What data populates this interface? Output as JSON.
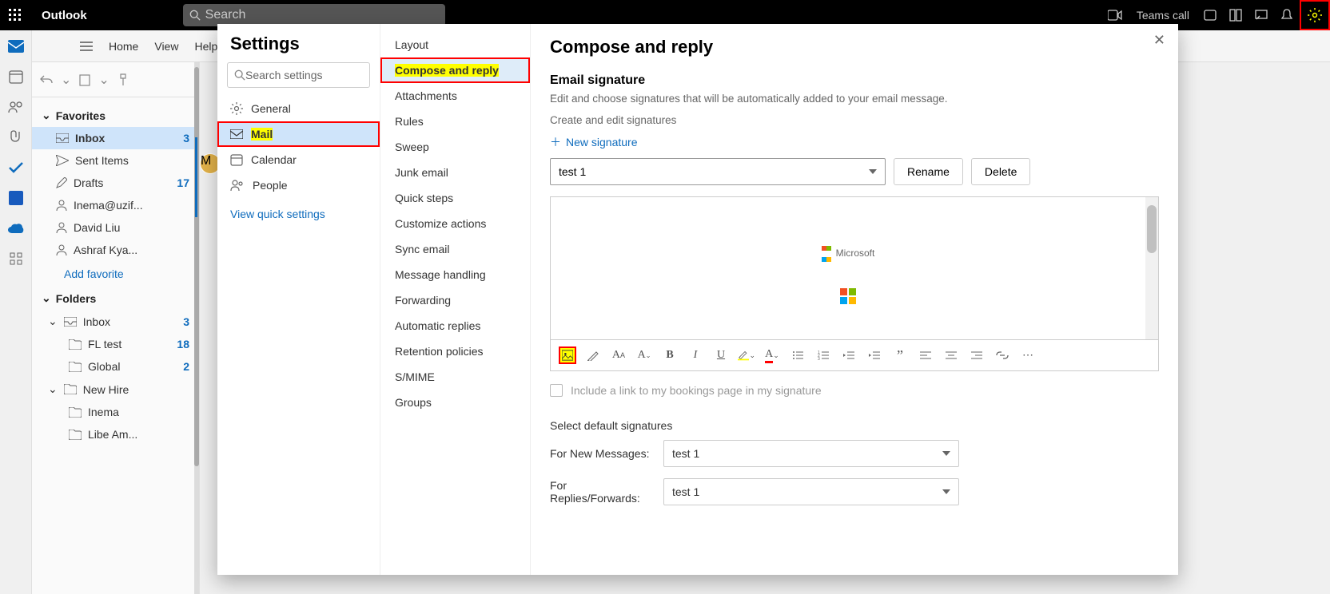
{
  "app": {
    "name": "Outlook",
    "search_placeholder": "Search",
    "teams_call": "Teams call"
  },
  "ribbon": {
    "tabs": [
      "Home",
      "View",
      "Help"
    ]
  },
  "favorites": {
    "header": "Favorites",
    "items": [
      {
        "label": "Inbox",
        "count": "3"
      },
      {
        "label": "Sent Items"
      },
      {
        "label": "Drafts",
        "count": "17"
      },
      {
        "label": "Inema@uzif..."
      },
      {
        "label": "David Liu"
      },
      {
        "label": "Ashraf Kya..."
      }
    ],
    "add": "Add favorite"
  },
  "folders": {
    "header": "Folders",
    "inbox": {
      "label": "Inbox",
      "count": "3"
    },
    "fltest": {
      "label": "FL test",
      "count": "18"
    },
    "global": {
      "label": "Global",
      "count": "2"
    },
    "newhire": {
      "label": "New Hire"
    },
    "inema": {
      "label": "Inema"
    },
    "libe": {
      "label": "Libe Am..."
    }
  },
  "settings": {
    "title": "Settings",
    "search_placeholder": "Search settings",
    "categories": [
      {
        "label": "General"
      },
      {
        "label": "Mail",
        "selected": true,
        "highlight": true
      },
      {
        "label": "Calendar"
      },
      {
        "label": "People"
      }
    ],
    "quick": "View quick settings",
    "mail_options": [
      "Layout",
      "Compose and reply",
      "Attachments",
      "Rules",
      "Sweep",
      "Junk email",
      "Quick steps",
      "Customize actions",
      "Sync email",
      "Message handling",
      "Forwarding",
      "Automatic replies",
      "Retention policies",
      "S/MIME",
      "Groups"
    ]
  },
  "compose": {
    "title": "Compose and reply",
    "section_title": "Email signature",
    "section_sub": "Edit and choose signatures that will be automatically added to your email message.",
    "create_label": "Create and edit signatures",
    "new_signature": "New signature",
    "signature_name": "test 1",
    "rename": "Rename",
    "delete": "Delete",
    "sig_brand": "Microsoft",
    "include_bookings": "Include a link to my bookings page in my signature",
    "defaults_header": "Select default signatures",
    "for_new": "For New Messages:",
    "for_replies": "For Replies/Forwards:",
    "default_new": "test 1",
    "default_reply": "test 1"
  }
}
